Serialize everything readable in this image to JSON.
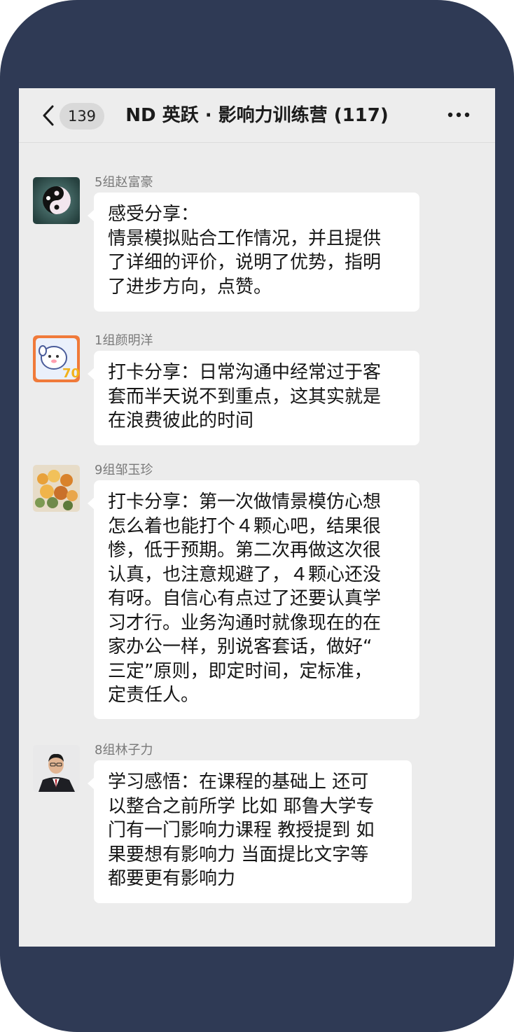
{
  "header": {
    "back_icon": "chevron-left-icon",
    "unread_count": "139",
    "title": "ND 英跃 · 影响力训练营 (117)",
    "more_icon": "more-dots-icon"
  },
  "messages": [
    {
      "sender": "5组赵富豪",
      "avatar_icon": "yin-yang-avatar",
      "lines": [
        "感受分享：",
        "情景模拟贴合工作情况，并且提供",
        "了详细的评价，说明了优势，指明",
        "了进步方向，点赞。"
      ]
    },
    {
      "sender": "1组颜明洋",
      "avatar_icon": "cartoon-dog-avatar",
      "lines": [
        "打卡分享：日常沟通中经常过于客",
        "套而半天说不到重点，这其实就是",
        "在浪费彼此的时间"
      ]
    },
    {
      "sender": "9组邹玉珍",
      "avatar_icon": "flower-bouquet-avatar",
      "lines": [
        "打卡分享：第一次做情景模仿心想",
        "怎么着也能打个４颗心吧，结果很",
        "惨，低于预期。第二次再做这次很",
        "认真，也注意规避了，４颗心还没",
        "有呀。自信心有点过了还要认真学",
        "习才行。业务沟通时就像现在的在",
        "家办公一样，别说客套话，做好“",
        "三定”原则，即定时间，定标准，",
        "定责任人。"
      ]
    },
    {
      "sender": "8组林子力",
      "avatar_icon": "man-in-suit-avatar",
      "lines": [
        "学习感悟：在课程的基础上 还可",
        "以整合之前所学 比如 耶鲁大学专",
        "门有一门影响力课程 教授提到 如",
        "果要想有影响力 当面提比文字等",
        "都要更有影响力"
      ]
    }
  ],
  "colors": {
    "frame": "#2f3a55",
    "chat_background": "#ececec",
    "bubble": "#ffffff",
    "sender_text": "#7a7a7a"
  }
}
